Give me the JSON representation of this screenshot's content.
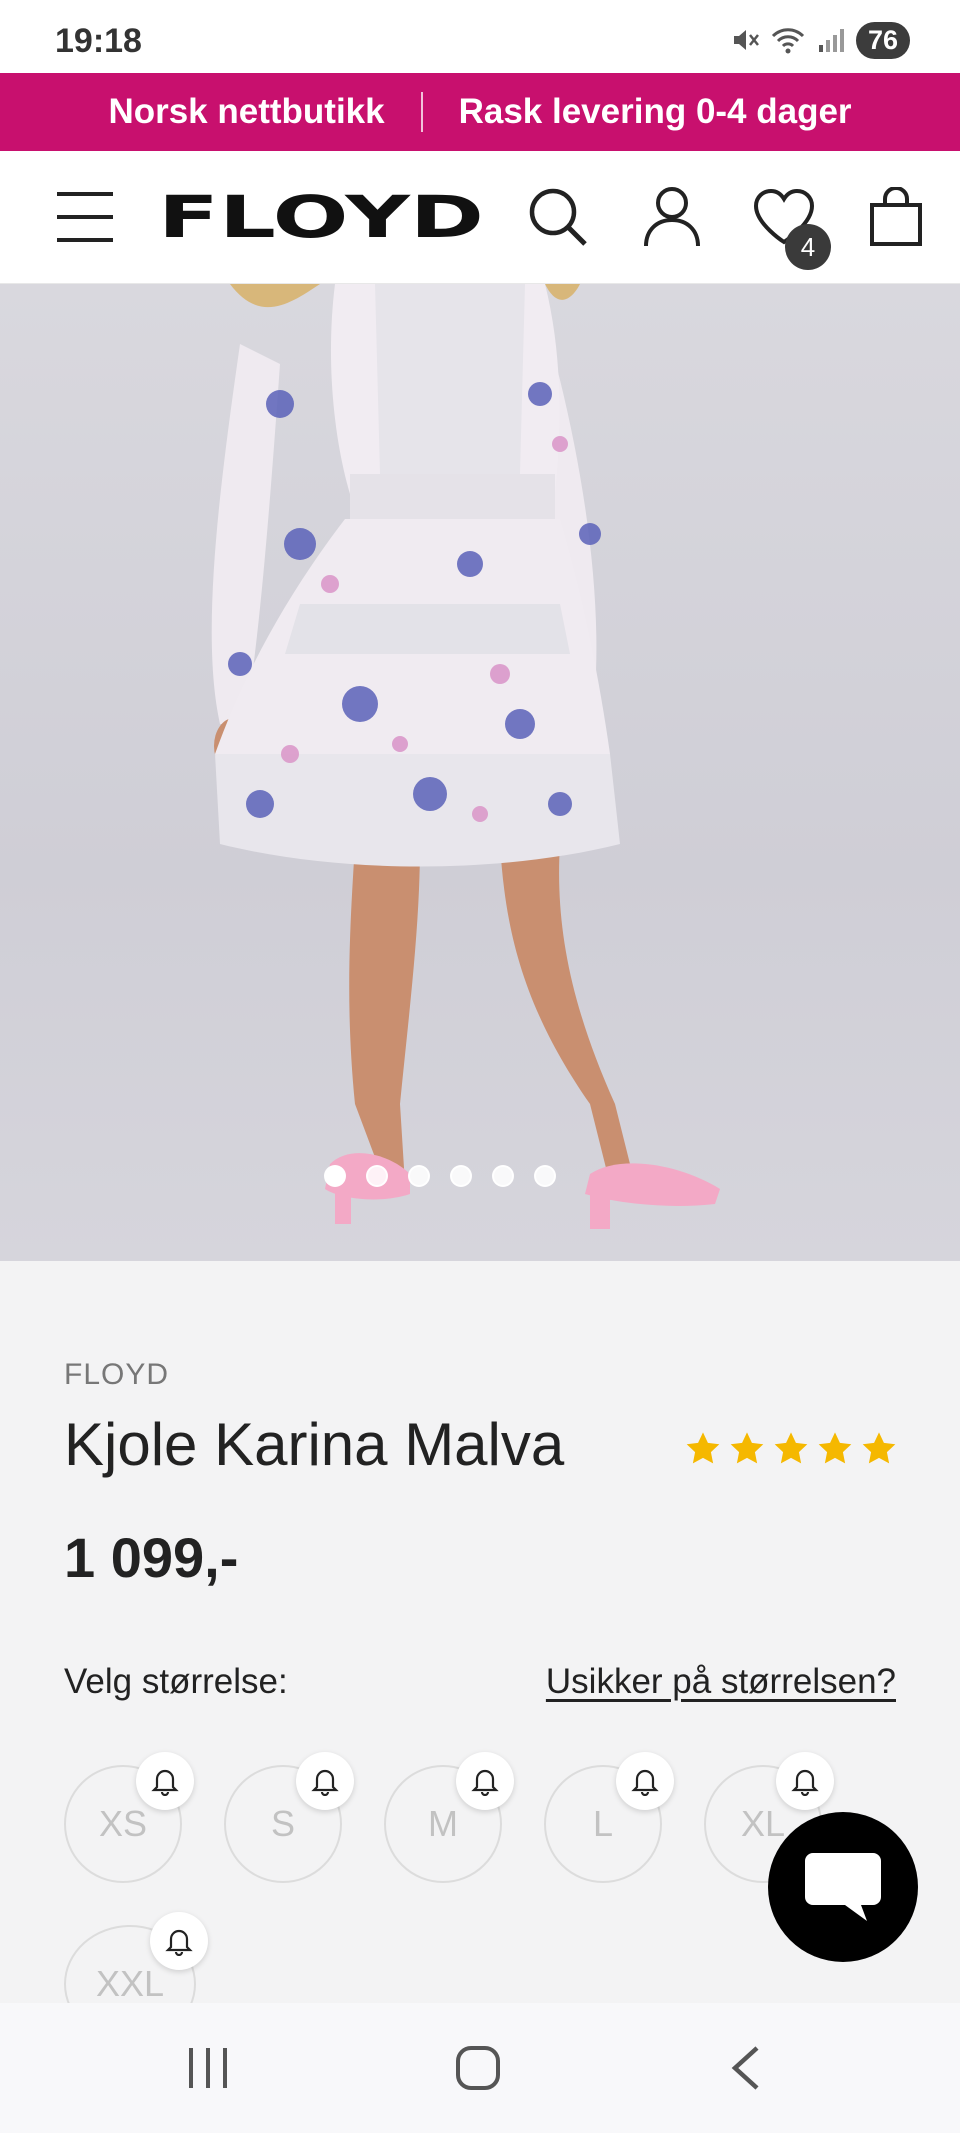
{
  "status_bar": {
    "time": "19:18",
    "battery": "76"
  },
  "promo": {
    "left_text": "Norsk nettbutikk",
    "right_text": "Rask levering 0-4 dager"
  },
  "header": {
    "logo_text": "FLOYD",
    "wishlist_count": "4"
  },
  "gallery": {
    "total_images": 6,
    "active_index": 0
  },
  "product": {
    "brand": "FLOYD",
    "title": "Kjole Karina Malva",
    "rating": 5,
    "price": "1 099,-"
  },
  "size_section": {
    "label": "Velg størrelse:",
    "guide_link": "Usikker på størrelsen?",
    "sizes": [
      "XS",
      "S",
      "M",
      "L",
      "XL",
      "XXL"
    ]
  },
  "colors": {
    "brand_pink": "#c8106e",
    "star_yellow": "#f5b800"
  },
  "icons": [
    "menu-icon",
    "search-icon",
    "account-icon",
    "heart-icon",
    "bag-icon",
    "bell-icon",
    "chat-icon"
  ]
}
